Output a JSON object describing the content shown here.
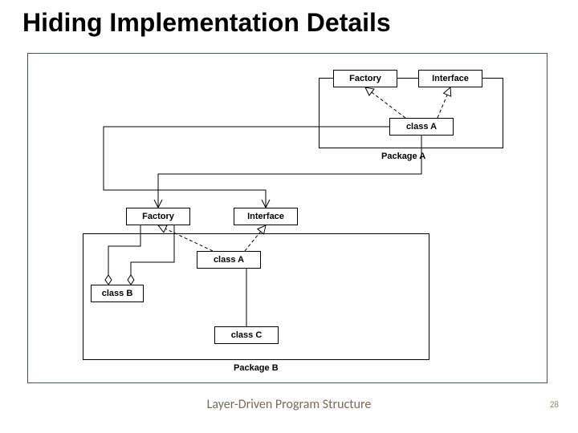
{
  "title": "Hiding Implementation Details",
  "footer": "Layer-Driven Program Structure",
  "page_number": "28",
  "packageA": {
    "label": "Package A",
    "factory": "Factory",
    "interface": "Interface",
    "classA": "class A"
  },
  "packageB": {
    "label": "Package B",
    "factory": "Factory",
    "interface": "Interface",
    "classA_top": "class A",
    "classB": "class B",
    "classC": "class C"
  }
}
